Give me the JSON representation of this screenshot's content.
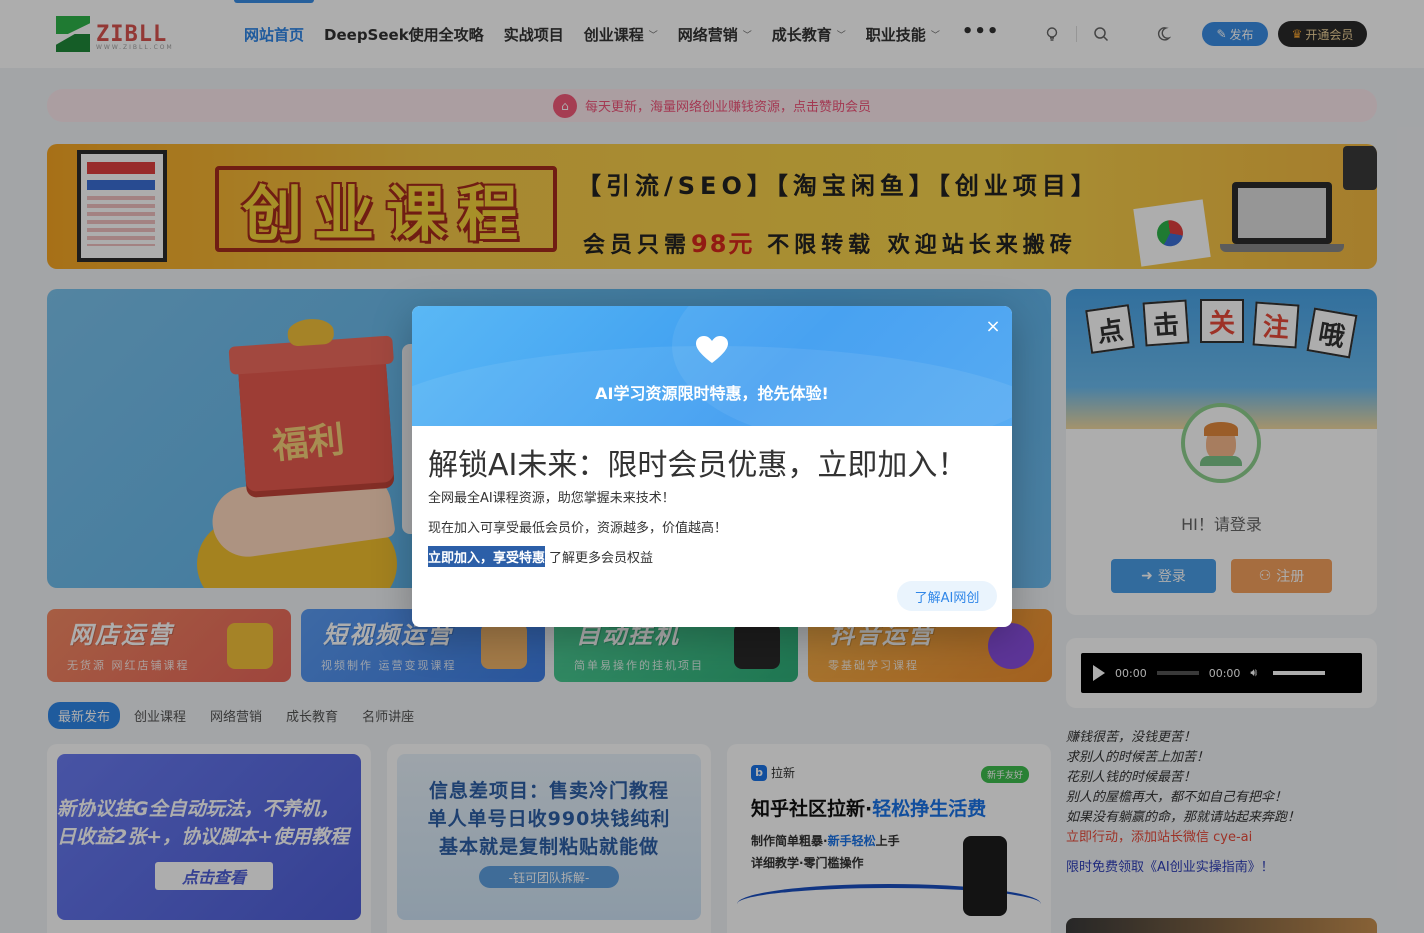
{
  "header": {
    "logo_text": "ZIBLL",
    "logo_sub": "WWW.ZIBLL.COM",
    "nav": [
      {
        "label": "网站首页",
        "active": true,
        "dropdown": false
      },
      {
        "label": "DeepSeek使用全攻略",
        "active": false,
        "dropdown": false
      },
      {
        "label": "实战项目",
        "active": false,
        "dropdown": false
      },
      {
        "label": "创业课程",
        "active": false,
        "dropdown": true
      },
      {
        "label": "网络营销",
        "active": false,
        "dropdown": true
      },
      {
        "label": "成长教育",
        "active": false,
        "dropdown": true
      },
      {
        "label": "职业技能",
        "active": false,
        "dropdown": true
      }
    ],
    "more": "•••",
    "icons": [
      "bulb-icon",
      "search-icon",
      "moon-icon"
    ],
    "publish_label": "发布",
    "vip_label": "开通会员",
    "accent": "#2f86e8"
  },
  "notice": {
    "text": "每天更新，海量网络创业赚钱资源，点击赞助会员"
  },
  "banner": {
    "title": "创业课程",
    "tags": "【引流/SEO】【淘宝闲鱼】【创业项目】",
    "sub_prefix": "会员只需",
    "price": "98元",
    "sub_suffix": "不限转载 欢迎站长来搬砖"
  },
  "hero": {
    "gift_label": "福利"
  },
  "tiles": [
    {
      "title": "网店运营",
      "sub": "无货源 网红店铺课程",
      "color": "#f27a5e"
    },
    {
      "title": "短视频运营",
      "sub": "视频制作 运营变现课程",
      "color": "#4b8ff0"
    },
    {
      "title": "自动挂机",
      "sub": "简单易操作的挂机项目",
      "color": "#3fbf8a"
    },
    {
      "title": "抖音运营",
      "sub": "零基础学习课程",
      "color": "#f4a23c"
    }
  ],
  "tabs": [
    "最新发布",
    "创业课程",
    "网络营销",
    "成长教育",
    "名师讲座"
  ],
  "posts": {
    "p1": {
      "line1": "新协议挂G全自动玩法，不养机，",
      "line2": "日收益2张+，协议脚本+使用教程",
      "cta": "点击查看"
    },
    "p2": {
      "line1": "信息差项目：售卖冷门教程",
      "line2": "单人单号日收990块钱纯利",
      "line3": "基本就是复制粘贴就能做",
      "tag": "-钰可团队拆解-"
    },
    "p3": {
      "brand": "拉新",
      "badge": "新手友好",
      "head_a": "知乎社区拉新·",
      "head_b": "轻松挣生活费",
      "d1_a": "制作简单粗暴·",
      "d1_b": "新手轻松",
      "d1_c": "上手",
      "d2": "详细教学·零门槛操作"
    }
  },
  "profile": {
    "signs": [
      "点",
      "击",
      "关",
      "注",
      "哦"
    ],
    "greeting": "HI！请登录",
    "login_label": "登录",
    "register_label": "注册"
  },
  "audio": {
    "current": "00:00",
    "duration": "00:00"
  },
  "quotes": {
    "lines": [
      "赚钱很苦，没钱更苦！",
      "求别人的时候苦上加苦！",
      "花别人钱的时候最苦！",
      "别人的屋檐再大，都不如自己有把伞！",
      "如果没有躺赢的命，那就请站起来奔跑！"
    ],
    "action": "立即行动，添加站长微信 cye-ai",
    "link": "限时免费领取《AI创业实操指南》！"
  },
  "modal": {
    "title": "AI学习资源限时特惠，抢先体验!",
    "heading": "解锁AI未来：限时会员优惠，立即加入！",
    "p1": "全网最全AI课程资源，助您掌握未来技术！",
    "p2": "现在加入可享受最低会员价，资源越多，价值越高！",
    "p3_highlight": "立即加入，享受特惠",
    "p3_rest": "了解更多会员权益",
    "button": "了解AI网创",
    "close": "×"
  }
}
